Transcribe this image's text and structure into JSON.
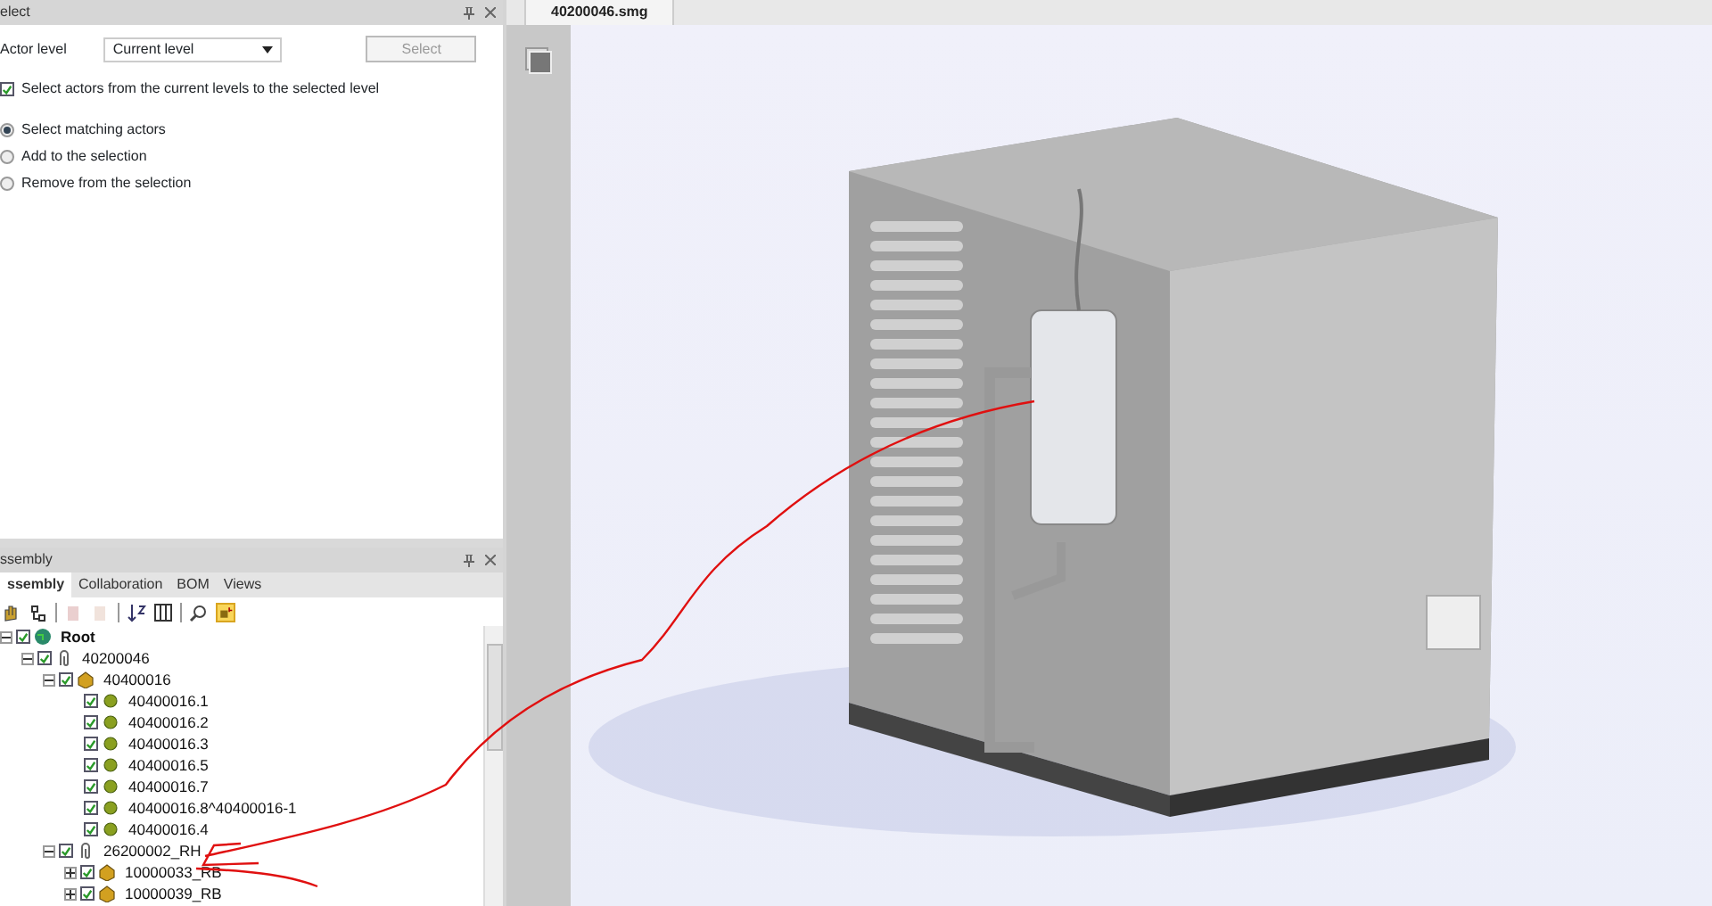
{
  "select_panel": {
    "title": "elect",
    "actor_level_label": "Actor level",
    "actor_level_value": "Current level",
    "select_button": {
      "label": "Select",
      "disabled": true
    },
    "checkbox": {
      "label": "Select actors from the current levels to the selected level",
      "checked": true
    },
    "options": [
      {
        "label": "Select matching actors",
        "selected": true
      },
      {
        "label": "Add to the selection",
        "selected": false
      },
      {
        "label": "Remove from the selection",
        "selected": false
      }
    ]
  },
  "assembly_panel": {
    "title": "ssembly",
    "tabs": [
      {
        "label": "ssembly",
        "selected": true
      },
      {
        "label": "Collaboration",
        "selected": false
      },
      {
        "label": "BOM",
        "selected": false
      },
      {
        "label": "Views",
        "selected": false
      }
    ],
    "toolbar": [
      {
        "kind": "hand",
        "disabled": false
      },
      {
        "kind": "tree",
        "disabled": false
      },
      {
        "kind": "hide",
        "disabled": true
      },
      {
        "kind": "show",
        "disabled": true
      },
      {
        "kind": "sort",
        "disabled": false
      },
      {
        "kind": "columns",
        "disabled": false
      },
      {
        "kind": "search",
        "disabled": false
      },
      {
        "kind": "highlight",
        "disabled": false,
        "selected": true
      }
    ],
    "tree": [
      {
        "label": "Root",
        "kind": "root",
        "checked": true,
        "expanded": true,
        "children": [
          {
            "label": "40200046",
            "kind": "assembly",
            "checked": true,
            "expanded": true,
            "children": [
              {
                "label": "40400016",
                "kind": "group",
                "checked": true,
                "expanded": true,
                "children": [
                  {
                    "label": "40400016.1",
                    "kind": "part",
                    "checked": true
                  },
                  {
                    "label": "40400016.2",
                    "kind": "part",
                    "checked": true
                  },
                  {
                    "label": "40400016.3",
                    "kind": "part",
                    "checked": true
                  },
                  {
                    "label": "40400016.5",
                    "kind": "part",
                    "checked": true
                  },
                  {
                    "label": "40400016.7",
                    "kind": "part",
                    "checked": true
                  },
                  {
                    "label": "40400016.8^40400016-1",
                    "kind": "part",
                    "checked": true
                  },
                  {
                    "label": "40400016.4",
                    "kind": "part",
                    "checked": true
                  }
                ]
              },
              {
                "label": "26200002_RH",
                "kind": "assembly",
                "checked": true,
                "expanded": true,
                "children": [
                  {
                    "label": "10000033_RB",
                    "kind": "group",
                    "checked": true,
                    "expanded": false
                  },
                  {
                    "label": "10000039_RB",
                    "kind": "group",
                    "checked": true,
                    "expanded": false
                  }
                ]
              }
            ]
          }
        ]
      }
    ]
  },
  "document_tab": {
    "label": "40200046.smg",
    "selected": true
  }
}
